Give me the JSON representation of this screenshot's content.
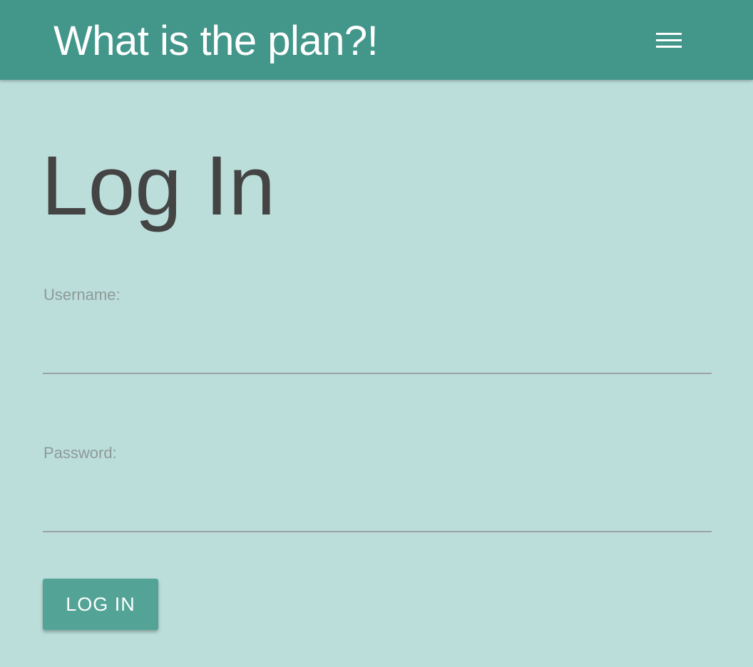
{
  "navbar": {
    "brand": "What is the plan?!",
    "menu_icon": "hamburger-menu-icon",
    "background_color": "#43968a"
  },
  "page": {
    "title": "Log In",
    "background_color": "#bbdeda"
  },
  "form": {
    "username": {
      "label": "Username:",
      "value": ""
    },
    "password": {
      "label": "Password:",
      "value": ""
    },
    "submit_label": "LOG IN",
    "button_color": "#53a497"
  }
}
